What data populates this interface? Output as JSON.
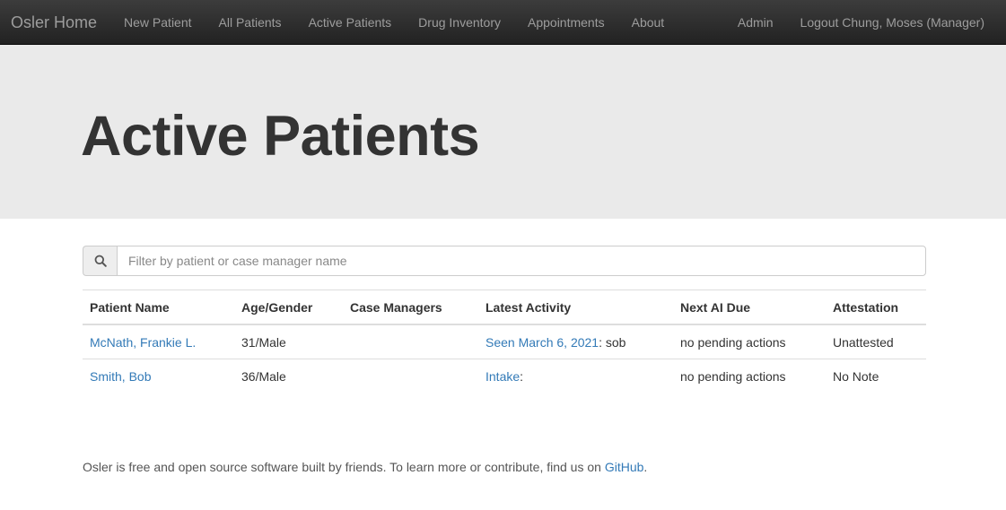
{
  "navbar": {
    "brand": "Osler Home",
    "links": [
      "New Patient",
      "All Patients",
      "Active Patients",
      "Drug Inventory",
      "Appointments",
      "About"
    ],
    "admin": "Admin",
    "logout": "Logout Chung, Moses (Manager)"
  },
  "page": {
    "title": "Active Patients"
  },
  "search": {
    "placeholder": "Filter by patient or case manager name",
    "value": ""
  },
  "table": {
    "headers": [
      "Patient Name",
      "Age/Gender",
      "Case Managers",
      "Latest Activity",
      "Next AI Due",
      "Attestation"
    ],
    "rows": [
      {
        "name": "McNath, Frankie L.",
        "age_gender": "31/Male",
        "case_managers": "",
        "activity_link": "Seen March 6, 2021",
        "activity_note": ": sob",
        "next_ai_due": "no pending actions",
        "attestation": "Unattested"
      },
      {
        "name": "Smith, Bob",
        "age_gender": "36/Male",
        "case_managers": "",
        "activity_link": "Intake",
        "activity_note": ":",
        "next_ai_due": "no pending actions",
        "attestation": "No Note"
      }
    ]
  },
  "footer": {
    "text": "Osler is free and open source software built by friends. To learn more or contribute, find us on ",
    "link": "GitHub",
    "end": "."
  },
  "colors": {
    "link": "#337ab7",
    "navbar": "#222222",
    "jumbotron": "#eaeaea"
  },
  "icons": {
    "search": "search-icon"
  }
}
